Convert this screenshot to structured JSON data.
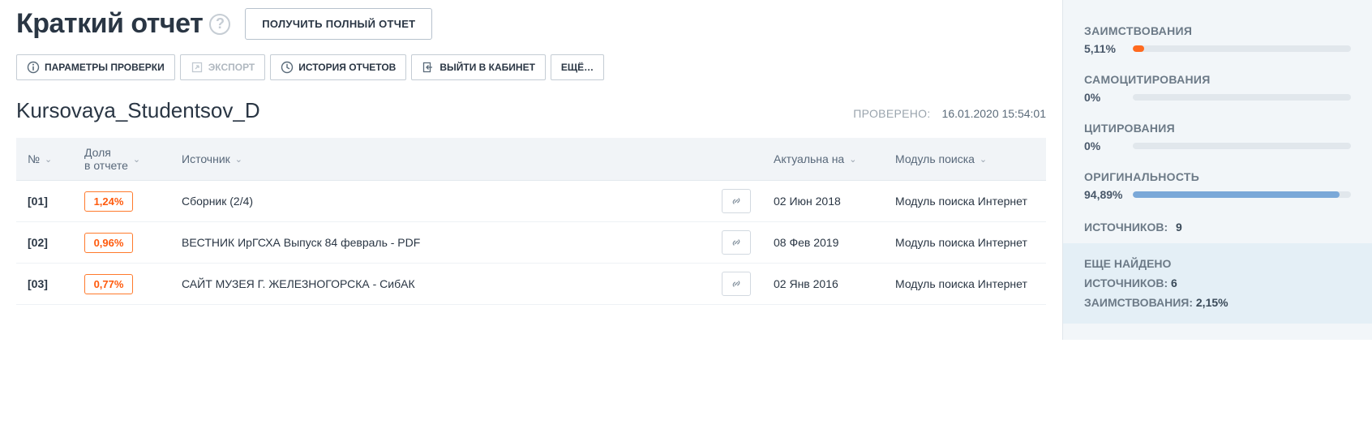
{
  "header": {
    "title": "Краткий отчет",
    "get_full_report": "ПОЛУЧИТЬ ПОЛНЫЙ ОТЧЕТ"
  },
  "toolbar": {
    "params": "ПАРАМЕТРЫ ПРОВЕРКИ",
    "export": "ЭКСПОРТ",
    "history": "ИСТОРИЯ ОТЧЕТОВ",
    "exit": "ВЫЙТИ В КАБИНЕТ",
    "more": "ЕЩЁ…"
  },
  "document": {
    "name": "Kursovaya_Studentsov_D",
    "checked_label": "ПРОВЕРЕНО:",
    "checked_at": "16.01.2020 15:54:01"
  },
  "table": {
    "headers": {
      "num": "№",
      "share_l1": "Доля",
      "share_l2": "в отчете",
      "source": "Источник",
      "actual": "Актуальна на",
      "module": "Модуль поиска"
    },
    "rows": [
      {
        "num": "[01]",
        "pct": "1,24%",
        "source": "Сборник (2/4)",
        "date": "02 Июн 2018",
        "module": "Модуль поиска Интернет"
      },
      {
        "num": "[02]",
        "pct": "0,96%",
        "source": "ВЕСТНИК ИрГСХА Выпуск 84 февраль - PDF",
        "date": "08 Фев 2019",
        "module": "Модуль поиска Интернет"
      },
      {
        "num": "[03]",
        "pct": "0,77%",
        "source": "САЙТ МУЗЕЯ Г. ЖЕЛЕЗНОГОРСКА - СибАК",
        "date": "02 Янв 2016",
        "module": "Модуль поиска Интернет"
      }
    ]
  },
  "stats": {
    "borrow": {
      "label": "ЗАИМСТВОВАНИЯ",
      "value": "5,11%",
      "width": 5.11
    },
    "selfcite": {
      "label": "САМОЦИТИРОВАНИЯ",
      "value": "0%",
      "width": 0
    },
    "cite": {
      "label": "ЦИТИРОВАНИЯ",
      "value": "0%",
      "width": 0
    },
    "original": {
      "label": "ОРИГИНАЛЬНОСТЬ",
      "value": "94,89%",
      "width": 94.89
    },
    "sources_label": "ИСТОЧНИКОВ:",
    "sources_count": "9",
    "extra": {
      "line1a": "ЕЩЕ НАЙДЕНО",
      "line1b": "ИСТОЧНИКОВ:",
      "extra_count": "6",
      "line2_label": "ЗАИМСТВОВАНИЯ:",
      "line2_val": "2,15%"
    }
  }
}
